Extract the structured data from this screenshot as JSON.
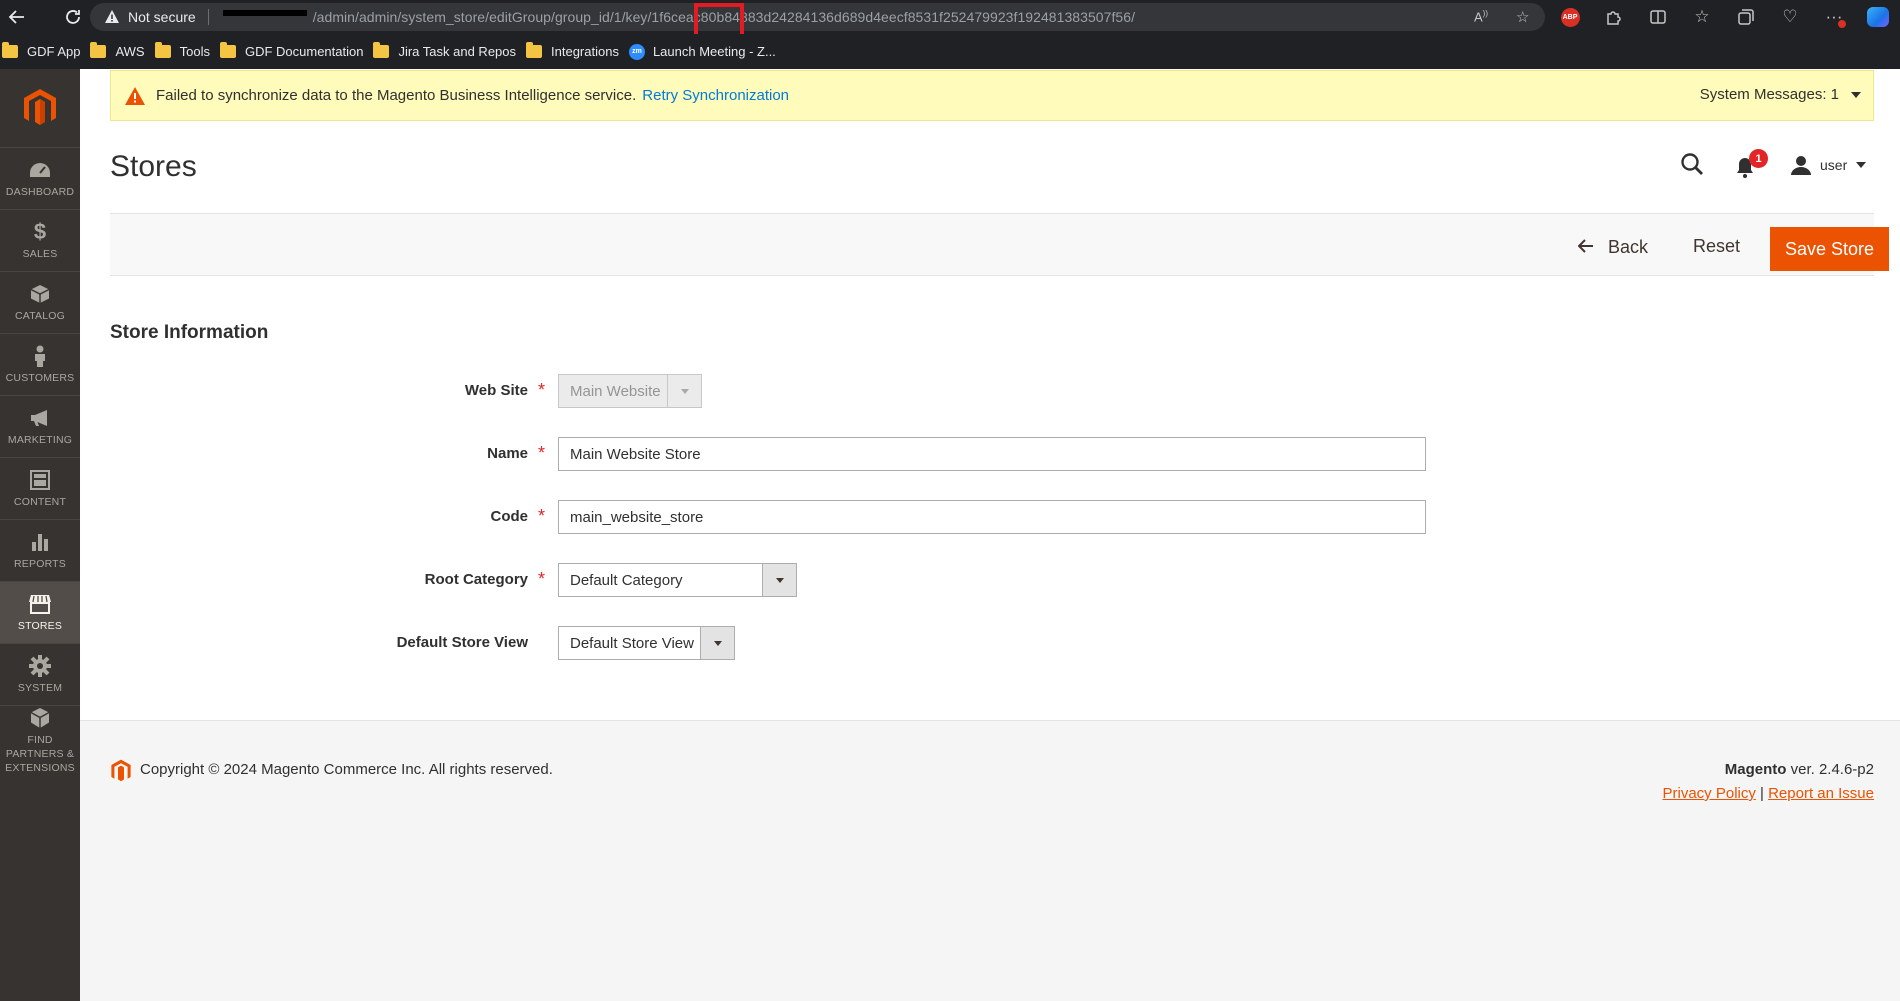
{
  "browser": {
    "not_secure_label": "Not secure",
    "url": "/admin/admin/system_store/editGroup/group_id/1/key/1f6ceac80b84883d24284136d689d4eecf8531f252479923f192481383507f56/",
    "bookmarks": [
      {
        "label": "GDF App",
        "icon": "folder-icon"
      },
      {
        "label": "AWS",
        "icon": "folder-icon"
      },
      {
        "label": "Tools",
        "icon": "folder-icon"
      },
      {
        "label": "GDF Documentation",
        "icon": "folder-icon"
      },
      {
        "label": "Jira Task and Repos",
        "icon": "folder-icon"
      },
      {
        "label": "Integrations",
        "icon": "folder-icon"
      },
      {
        "label": "Launch Meeting - Z...",
        "icon": "zoom-icon"
      }
    ],
    "abp_label": "ABP",
    "zoom_label": "zm"
  },
  "sidebar": {
    "items": [
      {
        "label": "DASHBOARD",
        "icon": "dashboard-icon"
      },
      {
        "label": "SALES",
        "icon": "dollar-icon"
      },
      {
        "label": "CATALOG",
        "icon": "box-icon"
      },
      {
        "label": "CUSTOMERS",
        "icon": "person-icon"
      },
      {
        "label": "MARKETING",
        "icon": "megaphone-icon"
      },
      {
        "label": "CONTENT",
        "icon": "layout-icon"
      },
      {
        "label": "REPORTS",
        "icon": "bar-chart-icon"
      },
      {
        "label": "STORES",
        "icon": "storefront-icon",
        "active": true
      },
      {
        "label": "SYSTEM",
        "icon": "gear-icon"
      },
      {
        "label": "FIND PARTNERS & EXTENSIONS",
        "icon": "extensions-icon"
      }
    ]
  },
  "system_message": {
    "text": "Failed to synchronize data to the Magento Business Intelligence service.",
    "link": "Retry Synchronization",
    "count_label": "System Messages: 1"
  },
  "header": {
    "title": "Stores",
    "notification_count": "1",
    "user": "user"
  },
  "actions": {
    "back": "Back",
    "reset": "Reset",
    "save": "Save Store"
  },
  "form": {
    "section_title": "Store Information",
    "fields": {
      "web_site": {
        "label": "Web Site",
        "value": "Main Website"
      },
      "name": {
        "label": "Name",
        "value": "Main Website Store"
      },
      "code": {
        "label": "Code",
        "value": "main_website_store"
      },
      "root_category": {
        "label": "Root Category",
        "value": "Default Category"
      },
      "default_store_view": {
        "label": "Default Store View",
        "value": "Default Store View"
      }
    },
    "required_mark": "*"
  },
  "footer": {
    "copyright": "Copyright © 2024 Magento Commerce Inc. All rights reserved.",
    "brand": "Magento",
    "version": " ver. 2.4.6-p2",
    "privacy": "Privacy Policy",
    "separator": " | ",
    "report": "Report an Issue"
  },
  "colors": {
    "accent": "#eb5202",
    "sidebar_bg": "#373330",
    "message_bg": "#fffbbb",
    "link": "#007bdb"
  }
}
